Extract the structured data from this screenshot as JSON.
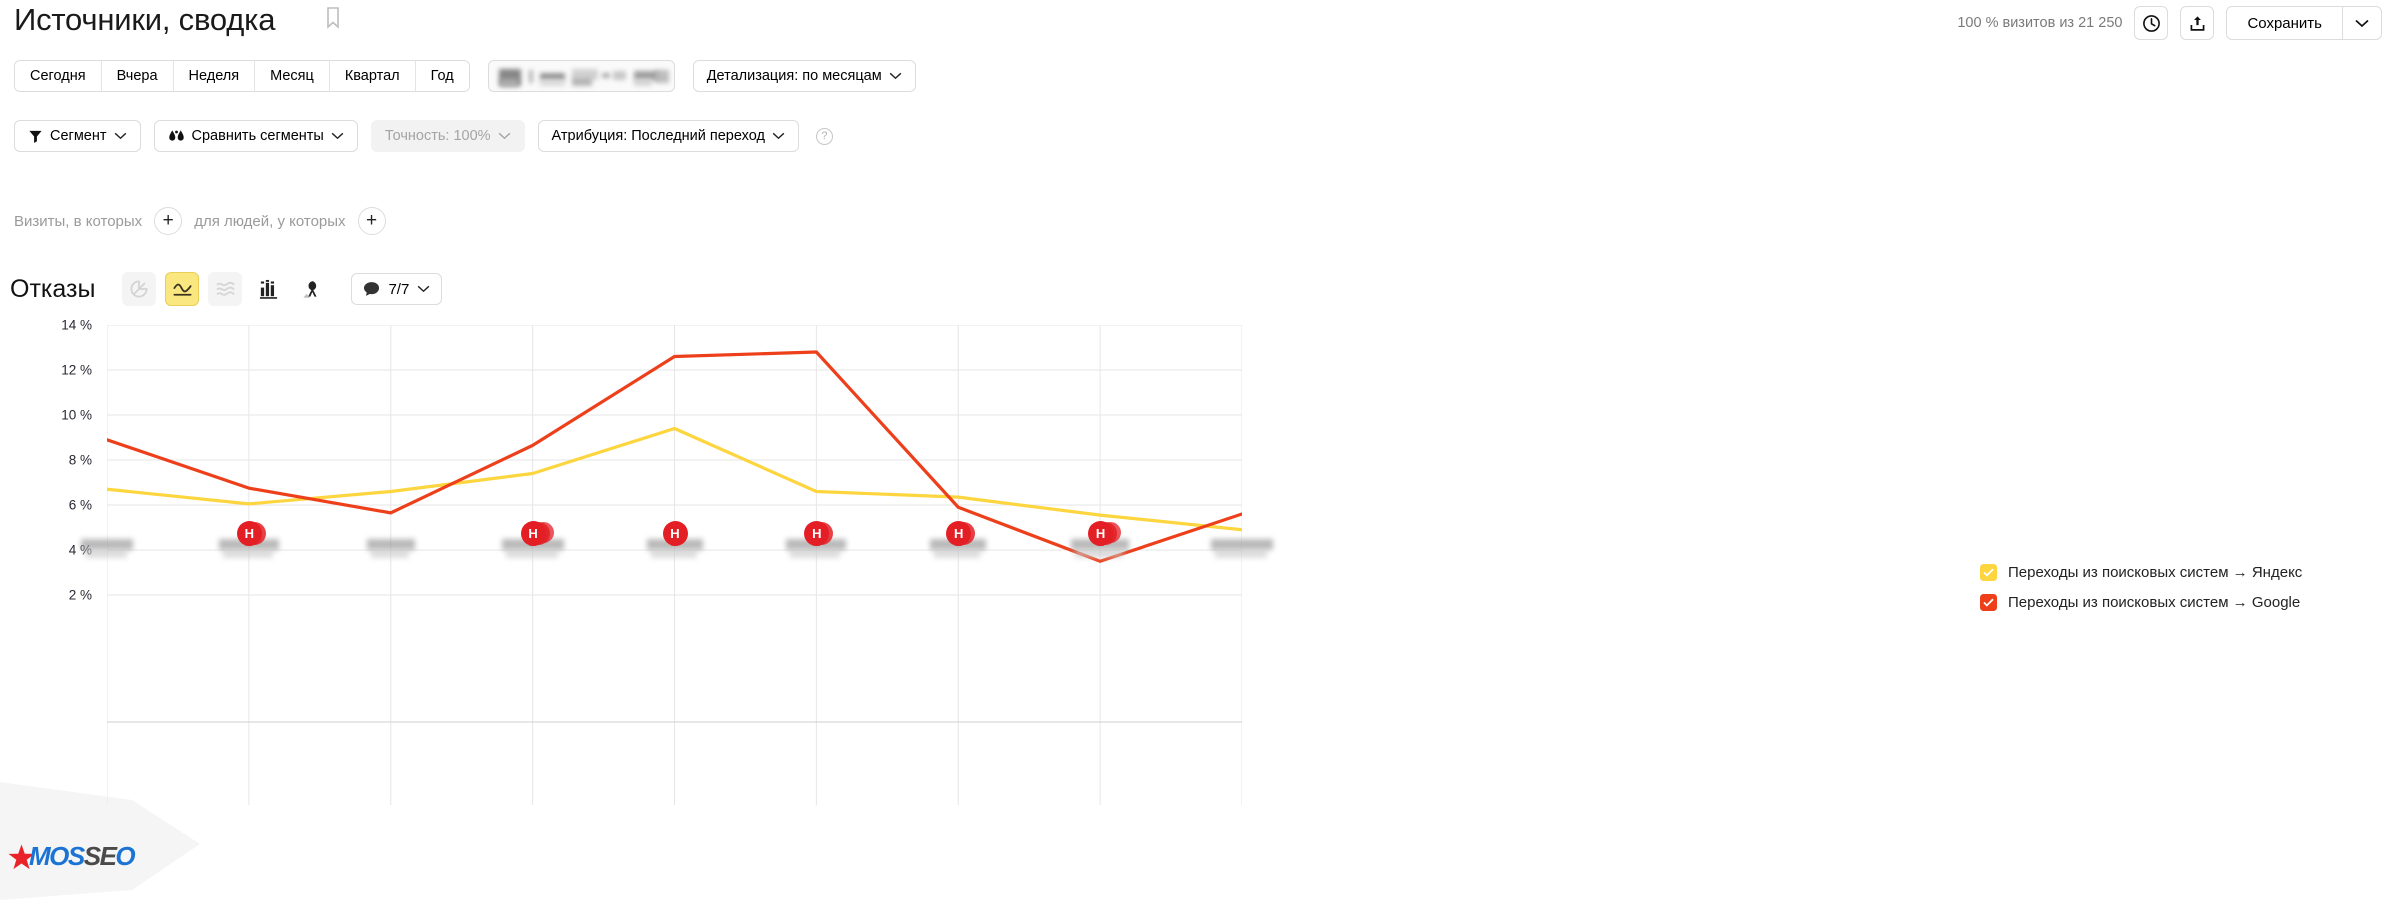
{
  "header": {
    "title": "Источники, сводка",
    "bookmark_icon": "bookmark-icon",
    "visits_info": "100 % визитов из 21 250",
    "history_icon": "clock-icon",
    "share_icon": "share-upload-icon",
    "save_label": "Сохранить",
    "save_caret_icon": "chevron-down-icon"
  },
  "toolbar_row1": {
    "period_tabs": [
      "Сегодня",
      "Вчера",
      "Неделя",
      "Месяц",
      "Квартал",
      "Год"
    ],
    "date_range_field": "",
    "detail_label": "Детализация: по месяцам",
    "detail_caret_icon": "chevron-down-icon"
  },
  "toolbar_row2": {
    "segment_label": "Сегмент",
    "segment_icon": "funnel-icon",
    "compare_label": "Сравнить сегменты",
    "compare_icon": "droplets-icon",
    "accuracy_label": "Точность: 100%",
    "attribution_label": "Атрибуция: Последний переход",
    "help_icon": "question-mark-icon",
    "help_glyph": "?"
  },
  "filter_row": {
    "visits_label": "Визиты, в которых",
    "people_label": "для людей, у которых",
    "add_glyph": "+",
    "add_icon": "plus-icon"
  },
  "chart_toolbar": {
    "metric_name": "Отказы",
    "view_types": [
      {
        "name": "pie-chart-icon",
        "state": "disabled"
      },
      {
        "name": "line-chart-icon",
        "state": "active"
      },
      {
        "name": "area-chart-icon",
        "state": "disabled"
      },
      {
        "name": "bar-chart-icon",
        "state": "enabled"
      },
      {
        "name": "map-pin-icon",
        "state": "enabled"
      }
    ],
    "comments_icon": "comment-bubble-icon",
    "comments_label": "7/7",
    "comments_caret_icon": "chevron-down-icon"
  },
  "chart_data": {
    "type": "line",
    "title": "Отказы",
    "xlabel": "",
    "ylabel": "%",
    "ylim": [
      2,
      14
    ],
    "yticks": [
      14,
      12,
      10,
      8,
      6,
      4,
      2
    ],
    "ytick_labels": [
      "14 %",
      "12 %",
      "10 %",
      "8 %",
      "6 %",
      "4 %",
      "2 %"
    ],
    "grid": true,
    "legend_position": "right",
    "x_labels_masked": true,
    "categories": [
      "",
      "",
      "",
      "",
      "",
      "",
      "",
      "",
      ""
    ],
    "series": [
      {
        "name": "Переходы из поисковых систем → Яндекс",
        "color": "#FCD53F",
        "checked": true,
        "values": [
          6.7,
          6.05,
          6.6,
          7.4,
          9.4,
          6.6,
          6.35,
          5.55,
          4.9
        ]
      },
      {
        "name": "Переходы из поисковых систем → Google",
        "color": "#EE3F1B",
        "checked": true,
        "values": [
          8.9,
          6.75,
          5.65,
          8.65,
          12.6,
          12.8,
          5.9,
          3.5,
          5.6
        ]
      }
    ],
    "annotations": [
      {
        "x_index": 0,
        "count": 0
      },
      {
        "x_index": 1,
        "count": 2,
        "glyph": "Н"
      },
      {
        "x_index": 2,
        "count": 0
      },
      {
        "x_index": 3,
        "count": 3,
        "glyph": "Н"
      },
      {
        "x_index": 4,
        "count": 1,
        "glyph": "Н"
      },
      {
        "x_index": 5,
        "count": 2,
        "glyph": "Н"
      },
      {
        "x_index": 6,
        "count": 2,
        "glyph": "Н"
      },
      {
        "x_index": 7,
        "count": 3,
        "glyph": "Н"
      }
    ]
  },
  "legend": {
    "items": [
      {
        "label": "Переходы из поисковых систем → Яндекс",
        "color": "#FCD53F",
        "checked": true
      },
      {
        "label": "Переходы из поисковых систем → Google",
        "color": "#EE3F1B",
        "checked": true
      }
    ]
  },
  "watermark": {
    "part1": "MOS",
    "part2": "SE",
    "part3": "O",
    "star_icon": "star-icon"
  }
}
